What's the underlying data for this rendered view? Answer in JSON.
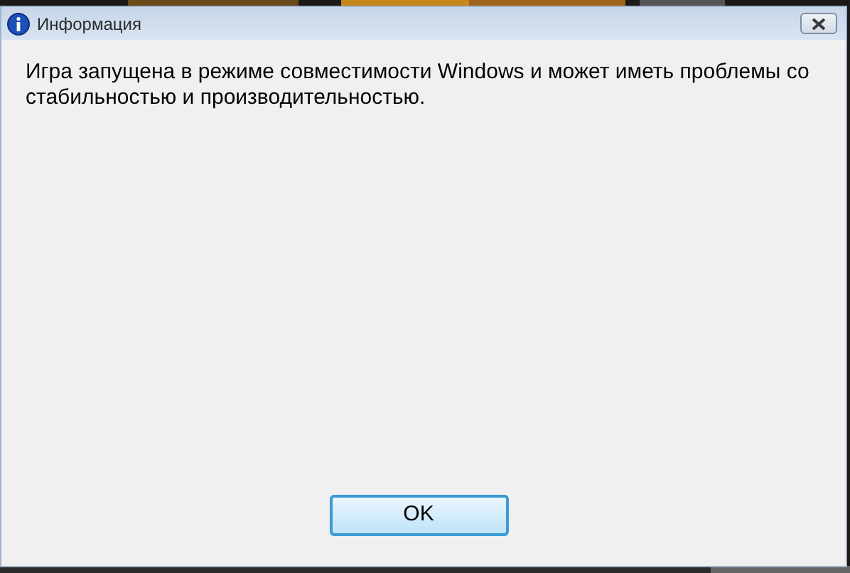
{
  "window": {
    "title": "Информация"
  },
  "message": "Игра запущена в режиме совместимости Windows и может иметь проблемы со стабильностью и производительностью.",
  "buttons": [
    {
      "label": "OK",
      "default": true
    }
  ]
}
